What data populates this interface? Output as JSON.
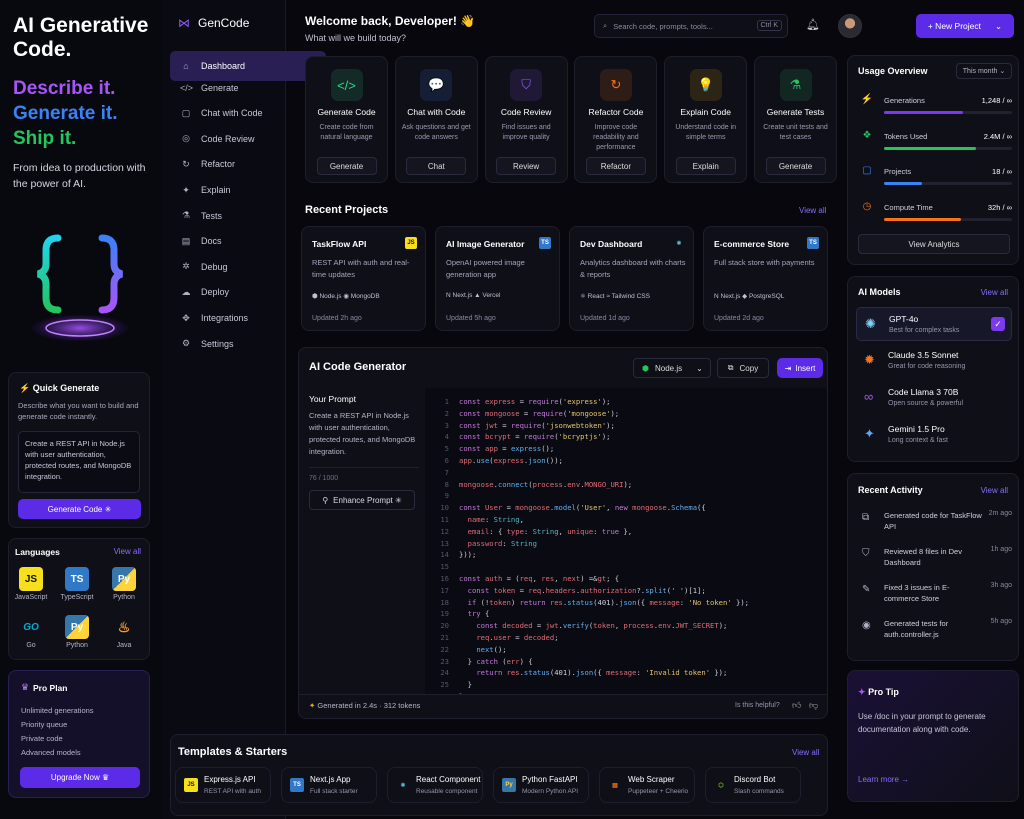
{
  "promo": {
    "headline": "AI Generative Code.",
    "tag1": "Describe it.",
    "tag2": "Generate it.",
    "tag3": "Ship it.",
    "subtitle": "From idea to production with the power of AI."
  },
  "quick": {
    "title": "Quick Generate",
    "desc": "Describe what you want to build and generate code instantly.",
    "prompt": "Create a REST API in Node.js with user authentication, protected routes, and MongoDB integration.",
    "button": "Generate Code ✳"
  },
  "languages": {
    "title": "Languages",
    "view_all": "View all",
    "items": [
      {
        "label": "JavaScript",
        "glyph": "JS"
      },
      {
        "label": "TypeScript",
        "glyph": "TS"
      },
      {
        "label": "Python",
        "glyph": "Py"
      },
      {
        "label": "Go",
        "glyph": "GO"
      },
      {
        "label": "Python",
        "glyph": "Py"
      },
      {
        "label": "Java",
        "glyph": "♨"
      }
    ]
  },
  "pro": {
    "title": "Pro Plan",
    "features": [
      "Unlimited generations",
      "Priority queue",
      "Private code",
      "Advanced models"
    ],
    "button": "Upgrade Now ♛"
  },
  "nav": {
    "logo": "GenCode",
    "items": [
      {
        "label": "Dashboard",
        "icon": "⌂"
      },
      {
        "label": "Generate",
        "icon": "</>"
      },
      {
        "label": "Chat with Code",
        "icon": "▢"
      },
      {
        "label": "Code Review",
        "icon": "◎"
      },
      {
        "label": "Refactor",
        "icon": "↻"
      },
      {
        "label": "Explain",
        "icon": "✦"
      },
      {
        "label": "Tests",
        "icon": "⚗"
      },
      {
        "label": "Docs",
        "icon": "▤"
      },
      {
        "label": "Debug",
        "icon": "✲"
      },
      {
        "label": "Deploy",
        "icon": "☁"
      },
      {
        "label": "Integrations",
        "icon": "✥"
      },
      {
        "label": "Settings",
        "icon": "⚙"
      }
    ]
  },
  "header": {
    "welcome": "Welcome back, Developer! 👋",
    "subtitle": "What will we build today?",
    "search": "Search code, prompts, tools...",
    "shortcut": "Ctrl K",
    "new_project": "+  New Project"
  },
  "actions": [
    {
      "title": "Generate Code",
      "desc": "Create code from natural language",
      "btn": "Generate",
      "icon": "</>",
      "color": "#2bd98a"
    },
    {
      "title": "Chat with Code",
      "desc": "Ask questions and get code answers",
      "btn": "Chat",
      "icon": "💬",
      "color": "#3b82f6"
    },
    {
      "title": "Code Review",
      "desc": "Find issues and improve quality",
      "btn": "Review",
      "icon": "⛉",
      "color": "#8b5cf6"
    },
    {
      "title": "Refactor Code",
      "desc": "Improve code readability and performance",
      "btn": "Refactor",
      "icon": "↻",
      "color": "#f97316"
    },
    {
      "title": "Explain Code",
      "desc": "Understand code in simple terms",
      "btn": "Explain",
      "icon": "💡",
      "color": "#eab308"
    },
    {
      "title": "Generate Tests",
      "desc": "Create unit tests and test cases",
      "btn": "Generate",
      "icon": "⚗",
      "color": "#22c55e"
    }
  ],
  "recent": {
    "title": "Recent Projects",
    "view_all": "View all",
    "items": [
      {
        "name": "TaskFlow API",
        "badge": "JS",
        "desc": "REST API with auth and real-time updates",
        "tags": "⬢ Node.js   ◉ MongoDB",
        "updated": "Updated 2h ago"
      },
      {
        "name": "AI Image Generator",
        "badge": "TS",
        "desc": "OpenAI powered image generation app",
        "tags": "N Next.js   ▲ Vercel",
        "updated": "Updated 5h ago"
      },
      {
        "name": "Dev Dashboard",
        "badge": "⚛",
        "desc": "Analytics dashboard with charts & reports",
        "tags": "⚛ React   ≈ Tailwind CSS",
        "updated": "Updated 1d ago"
      },
      {
        "name": "E-commerce Store",
        "badge": "TS",
        "desc": "Full stack store with payments",
        "tags": "N Next.js   ◆ PostgreSQL",
        "updated": "Updated 2d ago"
      }
    ]
  },
  "gen": {
    "title": "AI Code Generator",
    "runtime": "Node.js",
    "copy": "Copy",
    "insert": "Insert",
    "prompt_title": "Your Prompt",
    "prompt": "Create a REST API in Node.js with user authentication, protected routes, and MongoDB integration.",
    "count": "76 / 1000",
    "enhance": "Enhance Prompt ✳",
    "footer_time": "Generated in 2.4s",
    "footer_tokens": "312 tokens",
    "helpful": "Is this helpful?"
  },
  "code": [
    "const express = require('express');",
    "const mongoose = require('mongoose');",
    "const jwt = require('jsonwebtoken');",
    "const bcrypt = require('bcryptjs');",
    "const app = express();",
    "app.use(express.json());",
    "",
    "mongoose.connect(process.env.MONGO_URI);",
    "",
    "const User = mongoose.model('User', new mongoose.Schema({",
    "  name: String,",
    "  email: { type: String, unique: true },",
    "  password: String",
    "}));",
    "",
    "const auth = (req, res, next) => {",
    "  const token = req.headers.authorization?.split(' ')[1];",
    "  if (!token) return res.status(401).json({ message: 'No token' });",
    "  try {",
    "    const decoded = jwt.verify(token, process.env.JWT_SECRET);",
    "    req.user = decoded;",
    "    next();",
    "  } catch (err) {",
    "    return res.status(401).json({ message: 'Invalid token' });",
    "  }",
    "};"
  ],
  "usage": {
    "title": "Usage Overview",
    "period": "This month ⌄",
    "items": [
      {
        "name": "Generations",
        "value": "1,248 / ∞",
        "fill": 0.62,
        "color": "#7c3aed",
        "icon": "⚡"
      },
      {
        "name": "Tokens Used",
        "value": "2.4M / ∞",
        "fill": 0.72,
        "color": "#22c55e",
        "icon": "❖"
      },
      {
        "name": "Projects",
        "value": "18 / ∞",
        "fill": 0.3,
        "color": "#3b82f6",
        "icon": "▢"
      },
      {
        "name": "Compute Time",
        "value": "32h / ∞",
        "fill": 0.6,
        "color": "#f97316",
        "icon": "◷"
      }
    ],
    "button": "View Analytics"
  },
  "models": {
    "title": "AI Models",
    "view_all": "View all",
    "items": [
      {
        "name": "GPT-4o",
        "desc": "Best for complex tasks",
        "icon": "✺"
      },
      {
        "name": "Claude 3.5 Sonnet",
        "desc": "Great for code reasoning",
        "icon": "✹"
      },
      {
        "name": "Code Llama 3 70B",
        "desc": "Open source & powerful",
        "icon": "∞"
      },
      {
        "name": "Gemini 1.5 Pro",
        "desc": "Long context & fast",
        "icon": "✦"
      }
    ]
  },
  "activity": {
    "title": "Recent Activity",
    "view_all": "View all",
    "items": [
      {
        "text": "Generated code for TaskFlow API",
        "time": "2m ago",
        "icon": "⧉"
      },
      {
        "text": "Reviewed 8 files in Dev Dashboard",
        "time": "1h ago",
        "icon": "⛉"
      },
      {
        "text": "Fixed 3 issues in E-commerce Store",
        "time": "3h ago",
        "icon": "✎"
      },
      {
        "text": "Generated tests for auth.controller.js",
        "time": "5h ago",
        "icon": "◉"
      }
    ]
  },
  "tip": {
    "title": "Pro Tip",
    "text": "Use /doc in your prompt to generate documentation along with code.",
    "link": "Learn more →"
  },
  "templates": {
    "title": "Templates & Starters",
    "view_all": "View all",
    "items": [
      {
        "name": "Express.js API",
        "desc": "REST API with auth",
        "icon": "JS"
      },
      {
        "name": "Next.js App",
        "desc": "Full stack starter",
        "icon": "TS"
      },
      {
        "name": "React Component",
        "desc": "Reusable component",
        "icon": "⚛"
      },
      {
        "name": "Python FastAPI",
        "desc": "Modern Python API",
        "icon": "Py"
      },
      {
        "name": "Web Scraper",
        "desc": "Puppeteer + Cheerio",
        "icon": "▤"
      },
      {
        "name": "Discord Bot",
        "desc": "Slash commands",
        "icon": "⬡"
      }
    ]
  }
}
